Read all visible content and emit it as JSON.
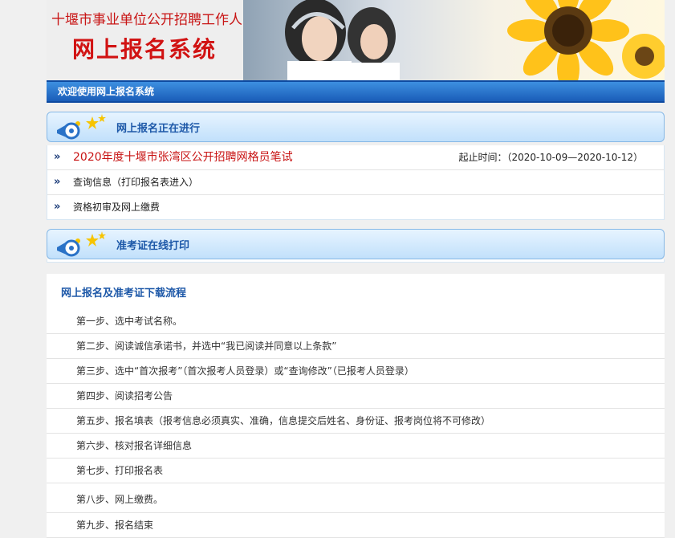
{
  "banner": {
    "org_title": "十堰市事业单位公开招聘工作人员",
    "system_title": "网上报名系统"
  },
  "welcome": "欢迎使用网上报名系统",
  "sections": {
    "ongoing": {
      "title": "网上报名正在进行",
      "exam": {
        "name": "2020年度十堰市张湾区公开招聘网格员笔试",
        "deadline_label": "起止时间：",
        "deadline_value": "（2020-10-09—2020-10-12）"
      },
      "links": [
        "查询信息（打印报名表进入）",
        "资格初审及网上缴费"
      ]
    },
    "admission": {
      "title": "准考证在线打印"
    }
  },
  "flow": {
    "title": "网上报名及准考证下载流程",
    "steps": [
      "第一步、选中考试名称。",
      "第二步、阅读诚信承诺书，并选中“我已阅读并同意以上条款”",
      "第三步、选中“首次报考”（首次报考人员登录）或“查询修改”（已报考人员登录）",
      "第四步、阅读招考公告",
      "第五步、报名填表（报考信息必须真实、准确，信息提交后姓名、身份证、报考岗位将不可修改）",
      "第六步、核对报名详细信息",
      "第七步、打印报名表",
      "第八步、网上缴费。",
      "第九步、报名结束"
    ]
  },
  "colors": {
    "accent_red": "#c81414",
    "accent_blue": "#1d58a8",
    "bar_blue": "#1a5db8"
  },
  "icons": [
    "loudspeaker-icon",
    "double-chevron-icon"
  ]
}
